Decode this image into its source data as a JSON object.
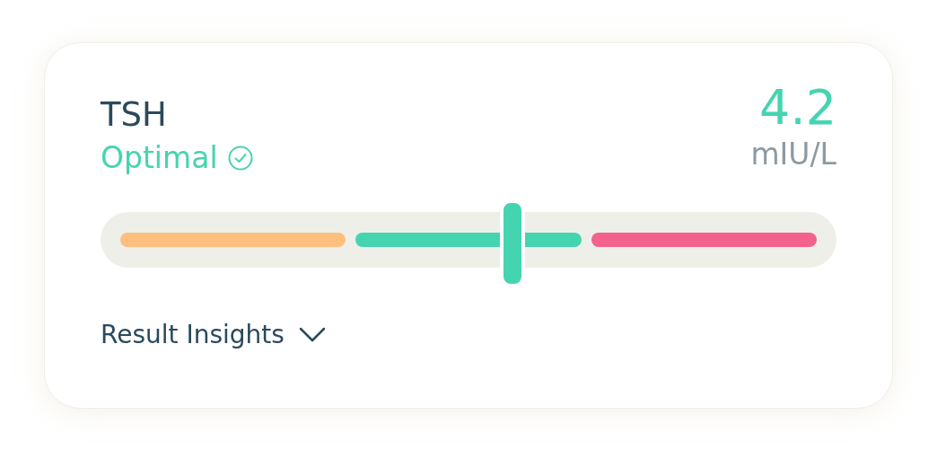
{
  "result": {
    "title": "TSH",
    "status": {
      "label": "Optimal",
      "kind": "optimal"
    },
    "value": "4.2",
    "unit": "mIU/L"
  },
  "range": {
    "level": 0.56,
    "segments": [
      {
        "color": "#fdbf7e"
      },
      {
        "color": "#45d4b0"
      },
      {
        "color": "#f2628b"
      }
    ]
  },
  "insights": {
    "label": "Result Insights",
    "expanded": false
  }
}
